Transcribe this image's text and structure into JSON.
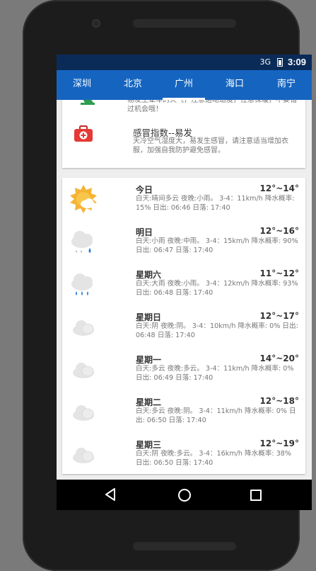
{
  "status_bar": {
    "signal_label": "3G",
    "time": "3:09"
  },
  "tabs": [
    {
      "label": "深圳",
      "active": false
    },
    {
      "label": "北京",
      "active": false
    },
    {
      "label": "广州",
      "active": true
    },
    {
      "label": "海口",
      "active": false
    },
    {
      "label": "南宁",
      "active": false
    }
  ],
  "indices": {
    "partial_text": "易发生晕车的天气，注意运动适度，注意保暖，不要错过机会哦！",
    "cold": {
      "title": "感冒指数--易发",
      "desc": "天冷空气湿度大，易发生感冒，请注意适当增加衣服，加强自我防护避免感冒。",
      "icon": "first-aid-kit-icon"
    }
  },
  "forecast": [
    {
      "day": "今日",
      "temp": "12°~14°",
      "desc": "白天:晴间多云 夜晚:小雨。 3-4：11km/h 降水概率: 15%  日出: 06:46  日落: 17:40",
      "icon": "sun-cloud-icon"
    },
    {
      "day": "明日",
      "temp": "12°~16°",
      "desc": "白天:小雨 夜晚:中雨。 3-4：15km/h 降水概率: 90%  日出: 06:47  日落: 17:40",
      "icon": "cloud-rain-icon"
    },
    {
      "day": "星期六",
      "temp": "11°~12°",
      "desc": "白天:大雨 夜晚:小雨。 3-4：12km/h 降水概率: 93%  日出: 06:48  日落: 17:40",
      "icon": "cloud-heavy-rain-icon"
    },
    {
      "day": "星期日",
      "temp": "12°~17°",
      "desc": "白天:阴 夜晚:阴。 3-4：10km/h 降水概率: 0%  日出: 06:48  日落: 17:40",
      "icon": "overcast-icon"
    },
    {
      "day": "星期一",
      "temp": "14°~20°",
      "desc": "白天:多云 夜晚:多云。 3-4：11km/h 降水概率: 0%  日出: 06:49  日落: 17:40",
      "icon": "cloudy-icon"
    },
    {
      "day": "星期二",
      "temp": "12°~18°",
      "desc": "白天:多云 夜晚:阴。 3-4：11km/h 降水概率: 0%  日出: 06:50  日落: 17:40",
      "icon": "cloudy-icon"
    },
    {
      "day": "星期三",
      "temp": "12°~19°",
      "desc": "白天:阴 夜晚:多云。 3-4：16km/h 降水概率: 38%  日出: 06:50  日落: 17:40",
      "icon": "overcast-icon"
    }
  ],
  "colors": {
    "tab_bar": "#1565c0",
    "status_bar": "#0a2b57",
    "kit_red": "#e53935"
  }
}
